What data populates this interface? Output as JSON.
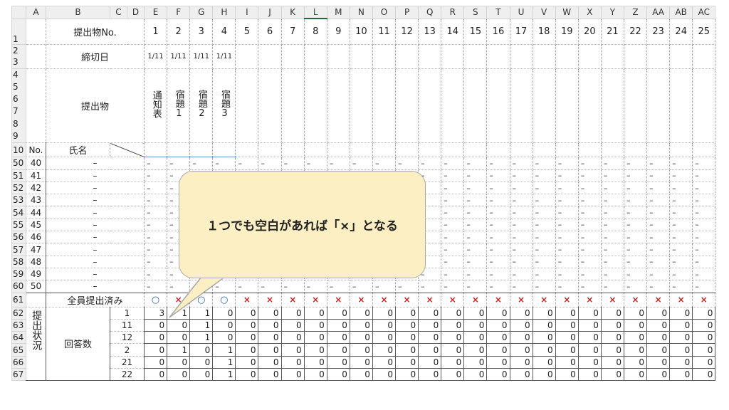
{
  "columns": [
    "A",
    "B",
    "C",
    "D",
    "E",
    "F",
    "G",
    "H",
    "I",
    "J",
    "K",
    "L",
    "M",
    "N",
    "O",
    "P",
    "Q",
    "R",
    "S",
    "T",
    "U",
    "V",
    "W",
    "X",
    "Y",
    "Z",
    "AA",
    "AB",
    "AC"
  ],
  "selected_column": "L",
  "labels": {
    "submission_no": "提出物No.",
    "deadline": "締切日",
    "submission": "提出物",
    "no": "No.",
    "name": "氏名",
    "all_submitted": "全員提出済み",
    "status": "提出状況",
    "answer_count": "回答数"
  },
  "item_numbers": [
    "1",
    "2",
    "3",
    "4",
    "5",
    "6",
    "7",
    "8",
    "9",
    "10",
    "11",
    "12",
    "13",
    "14",
    "15",
    "16",
    "17",
    "18",
    "19",
    "20",
    "21",
    "22",
    "23",
    "24",
    "25"
  ],
  "deadlines": [
    "1/11",
    "1/11",
    "1/11",
    "1/11"
  ],
  "item_names": [
    "通知表",
    "宿題1",
    "宿題2",
    "宿題3"
  ],
  "student_rows": [
    {
      "row": "50",
      "no": "40"
    },
    {
      "row": "51",
      "no": "41"
    },
    {
      "row": "52",
      "no": "42"
    },
    {
      "row": "53",
      "no": "43"
    },
    {
      "row": "54",
      "no": "44"
    },
    {
      "row": "55",
      "no": "45"
    },
    {
      "row": "56",
      "no": "46"
    },
    {
      "row": "57",
      "no": "47"
    },
    {
      "row": "58",
      "no": "48"
    },
    {
      "row": "59",
      "no": "49"
    },
    {
      "row": "60",
      "no": "50"
    }
  ],
  "dash": "–",
  "all_submitted": [
    "○",
    "×",
    "○",
    "○",
    "×",
    "×",
    "×",
    "×",
    "×",
    "×",
    "×",
    "×",
    "×",
    "×",
    "×",
    "×",
    "×",
    "×",
    "×",
    "×",
    "×",
    "×",
    "×",
    "×",
    "×"
  ],
  "count_rows": [
    {
      "row": "62",
      "key": "1",
      "values": [
        "3",
        "1",
        "1",
        "0",
        "0",
        "0",
        "0",
        "0",
        "0",
        "0",
        "0",
        "0",
        "0",
        "0",
        "0",
        "0",
        "0",
        "0",
        "0",
        "0",
        "0",
        "0",
        "0",
        "0",
        "0"
      ]
    },
    {
      "row": "63",
      "key": "11",
      "values": [
        "0",
        "0",
        "1",
        "0",
        "0",
        "0",
        "0",
        "0",
        "0",
        "0",
        "0",
        "0",
        "0",
        "0",
        "0",
        "0",
        "0",
        "0",
        "0",
        "0",
        "0",
        "0",
        "0",
        "0",
        "0"
      ]
    },
    {
      "row": "64",
      "key": "12",
      "values": [
        "0",
        "0",
        "1",
        "0",
        "0",
        "0",
        "0",
        "0",
        "0",
        "0",
        "0",
        "0",
        "0",
        "0",
        "0",
        "0",
        "0",
        "0",
        "0",
        "0",
        "0",
        "0",
        "0",
        "0",
        "0"
      ]
    },
    {
      "row": "65",
      "key": "2",
      "values": [
        "0",
        "1",
        "0",
        "1",
        "0",
        "0",
        "0",
        "0",
        "0",
        "0",
        "0",
        "0",
        "0",
        "0",
        "0",
        "0",
        "0",
        "0",
        "0",
        "0",
        "0",
        "0",
        "0",
        "0",
        "0"
      ]
    },
    {
      "row": "66",
      "key": "21",
      "values": [
        "0",
        "0",
        "0",
        "1",
        "0",
        "0",
        "0",
        "0",
        "0",
        "0",
        "0",
        "0",
        "0",
        "0",
        "0",
        "0",
        "0",
        "0",
        "0",
        "0",
        "0",
        "0",
        "0",
        "0",
        "0"
      ]
    },
    {
      "row": "67",
      "key": "22",
      "values": [
        "0",
        "0",
        "0",
        "1",
        "0",
        "0",
        "0",
        "0",
        "0",
        "0",
        "0",
        "0",
        "0",
        "0",
        "0",
        "0",
        "0",
        "0",
        "0",
        "0",
        "0",
        "0",
        "0",
        "0",
        "0"
      ]
    }
  ],
  "callout": "１つでも空白があれば「×」となる",
  "colors": {
    "circle": "#2f5fa6",
    "cross": "#d21f1f",
    "callout_fill": "#fdefc4",
    "selected_column": "#1b6b3a"
  }
}
